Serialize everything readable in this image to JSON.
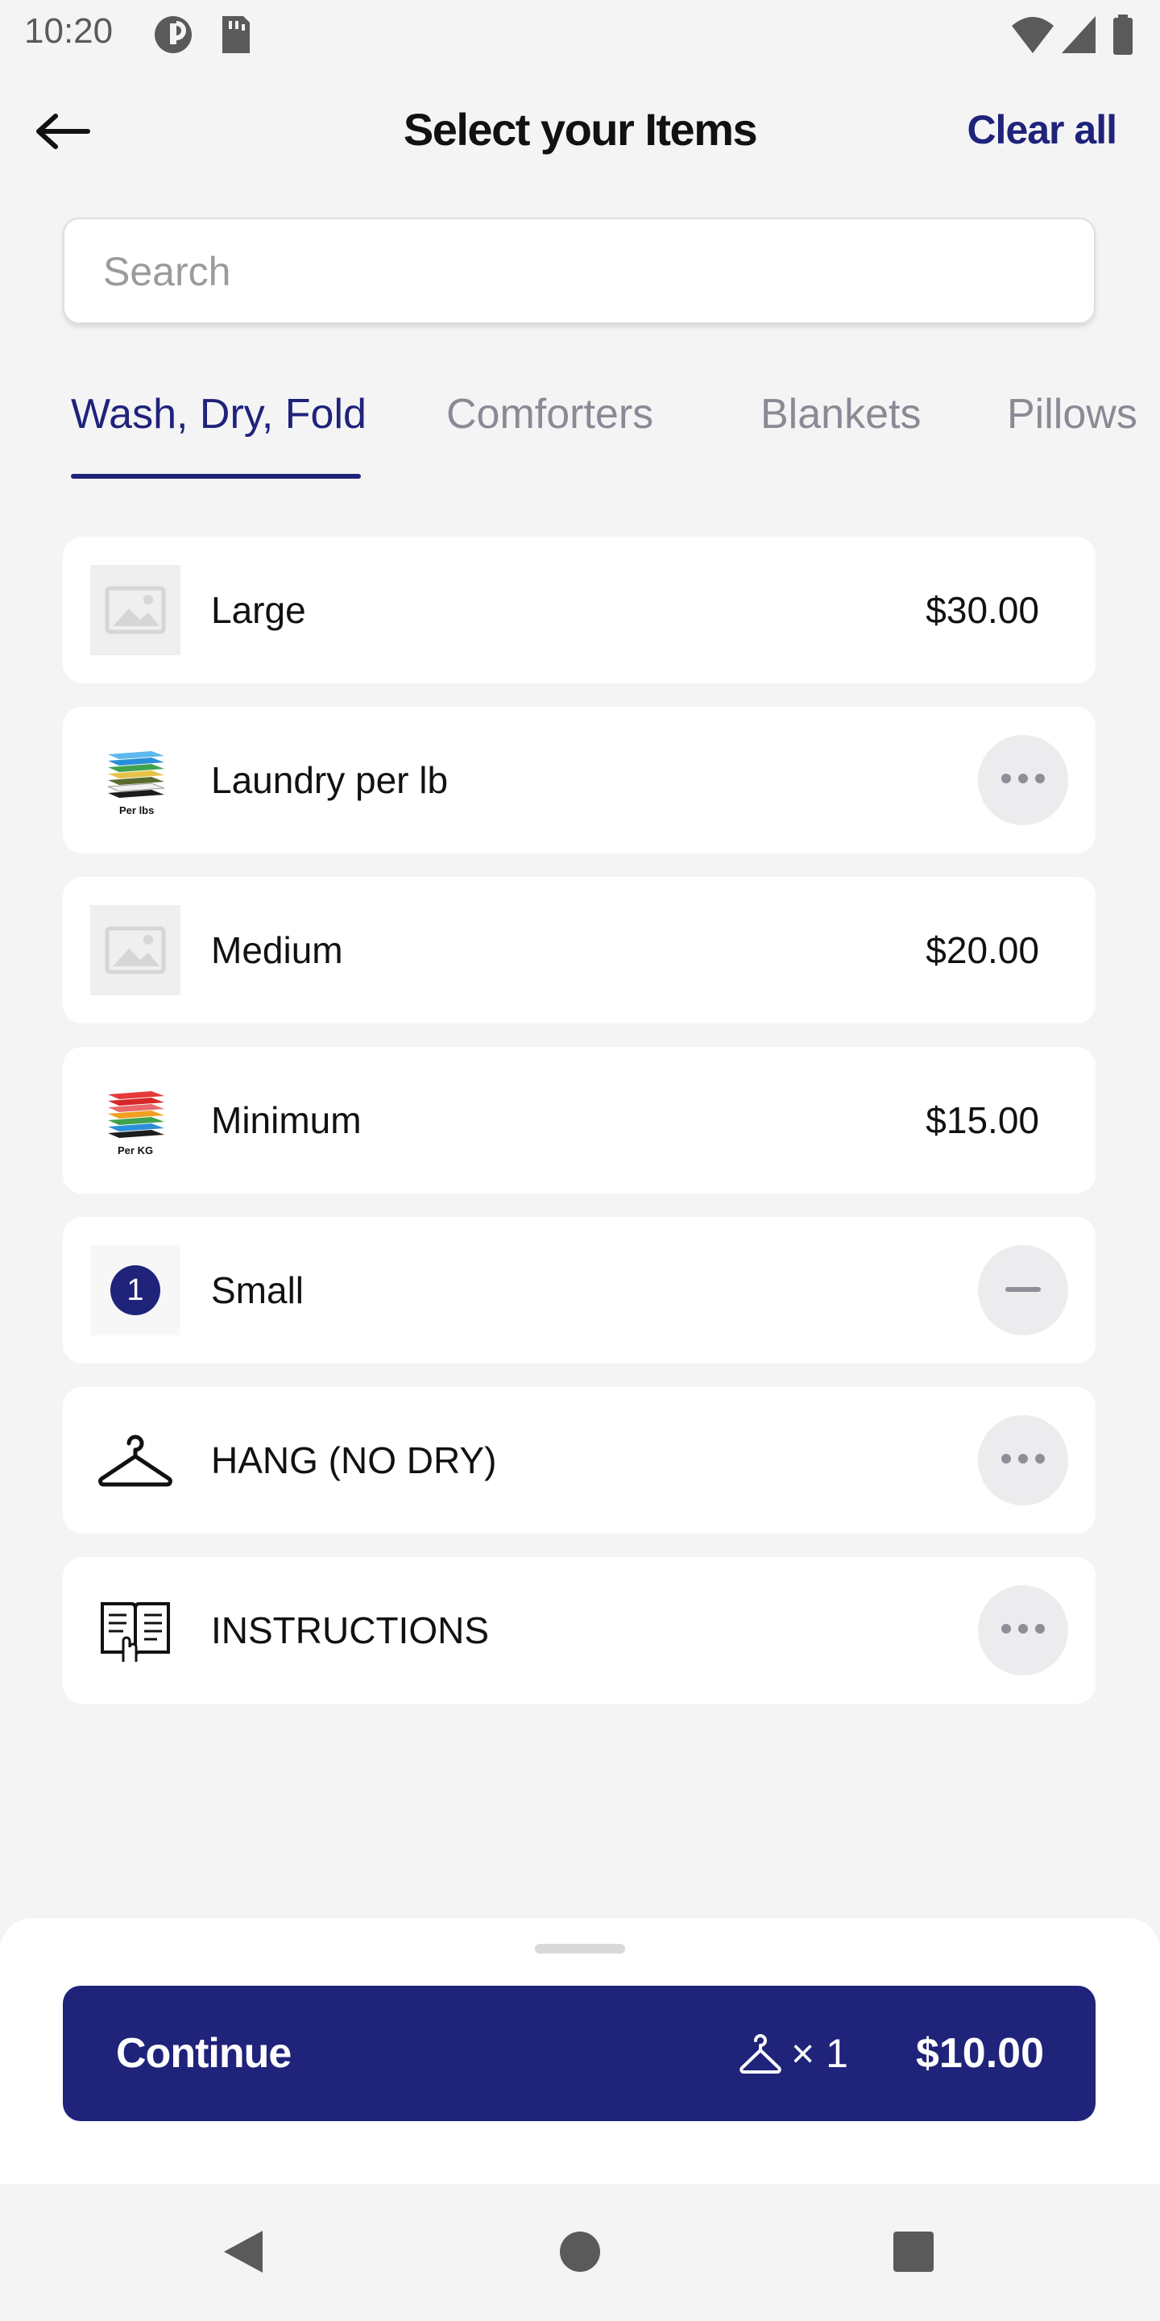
{
  "status_bar": {
    "time": "10:20",
    "icons": [
      "app-notification-icon",
      "sd-card-icon",
      "wifi-icon",
      "signal-icon",
      "battery-icon"
    ]
  },
  "header": {
    "title": "Select your Items",
    "clear_all": "Clear all",
    "back_icon": "arrow-left-icon"
  },
  "search": {
    "placeholder": "Search",
    "value": ""
  },
  "tabs": [
    {
      "label": "Wash, Dry, Fold",
      "active": true
    },
    {
      "label": "Comforters",
      "active": false
    },
    {
      "label": "Blankets",
      "active": false
    },
    {
      "label": "Pillows",
      "active": false
    }
  ],
  "items": [
    {
      "name": "Large",
      "price": "$30.00",
      "thumb": "image-placeholder-icon"
    },
    {
      "name": "Laundry per lb",
      "price": "",
      "thumb": "laundry-stack-blue-icon",
      "thumb_caption": "Per lbs",
      "action": "more-icon"
    },
    {
      "name": "Medium",
      "price": "$20.00",
      "thumb": "image-placeholder-icon"
    },
    {
      "name": "Minimum",
      "price": "$15.00",
      "thumb": "laundry-stack-red-icon",
      "thumb_caption": "Per KG"
    },
    {
      "name": "Small",
      "price": "",
      "quantity": "1",
      "action": "minus-icon"
    },
    {
      "name": "HANG (NO DRY)",
      "price": "",
      "thumb": "hanger-icon",
      "action": "more-icon"
    },
    {
      "name": "INSTRUCTIONS",
      "price": "",
      "thumb": "instructions-book-icon",
      "action": "more-icon"
    }
  ],
  "checkout": {
    "continue_label": "Continue",
    "count": "× 1",
    "total": "$10.00"
  },
  "colors": {
    "accent": "#1f237a",
    "background": "#f4f4f5",
    "card": "#ffffff",
    "muted_text": "#8a8a95"
  }
}
